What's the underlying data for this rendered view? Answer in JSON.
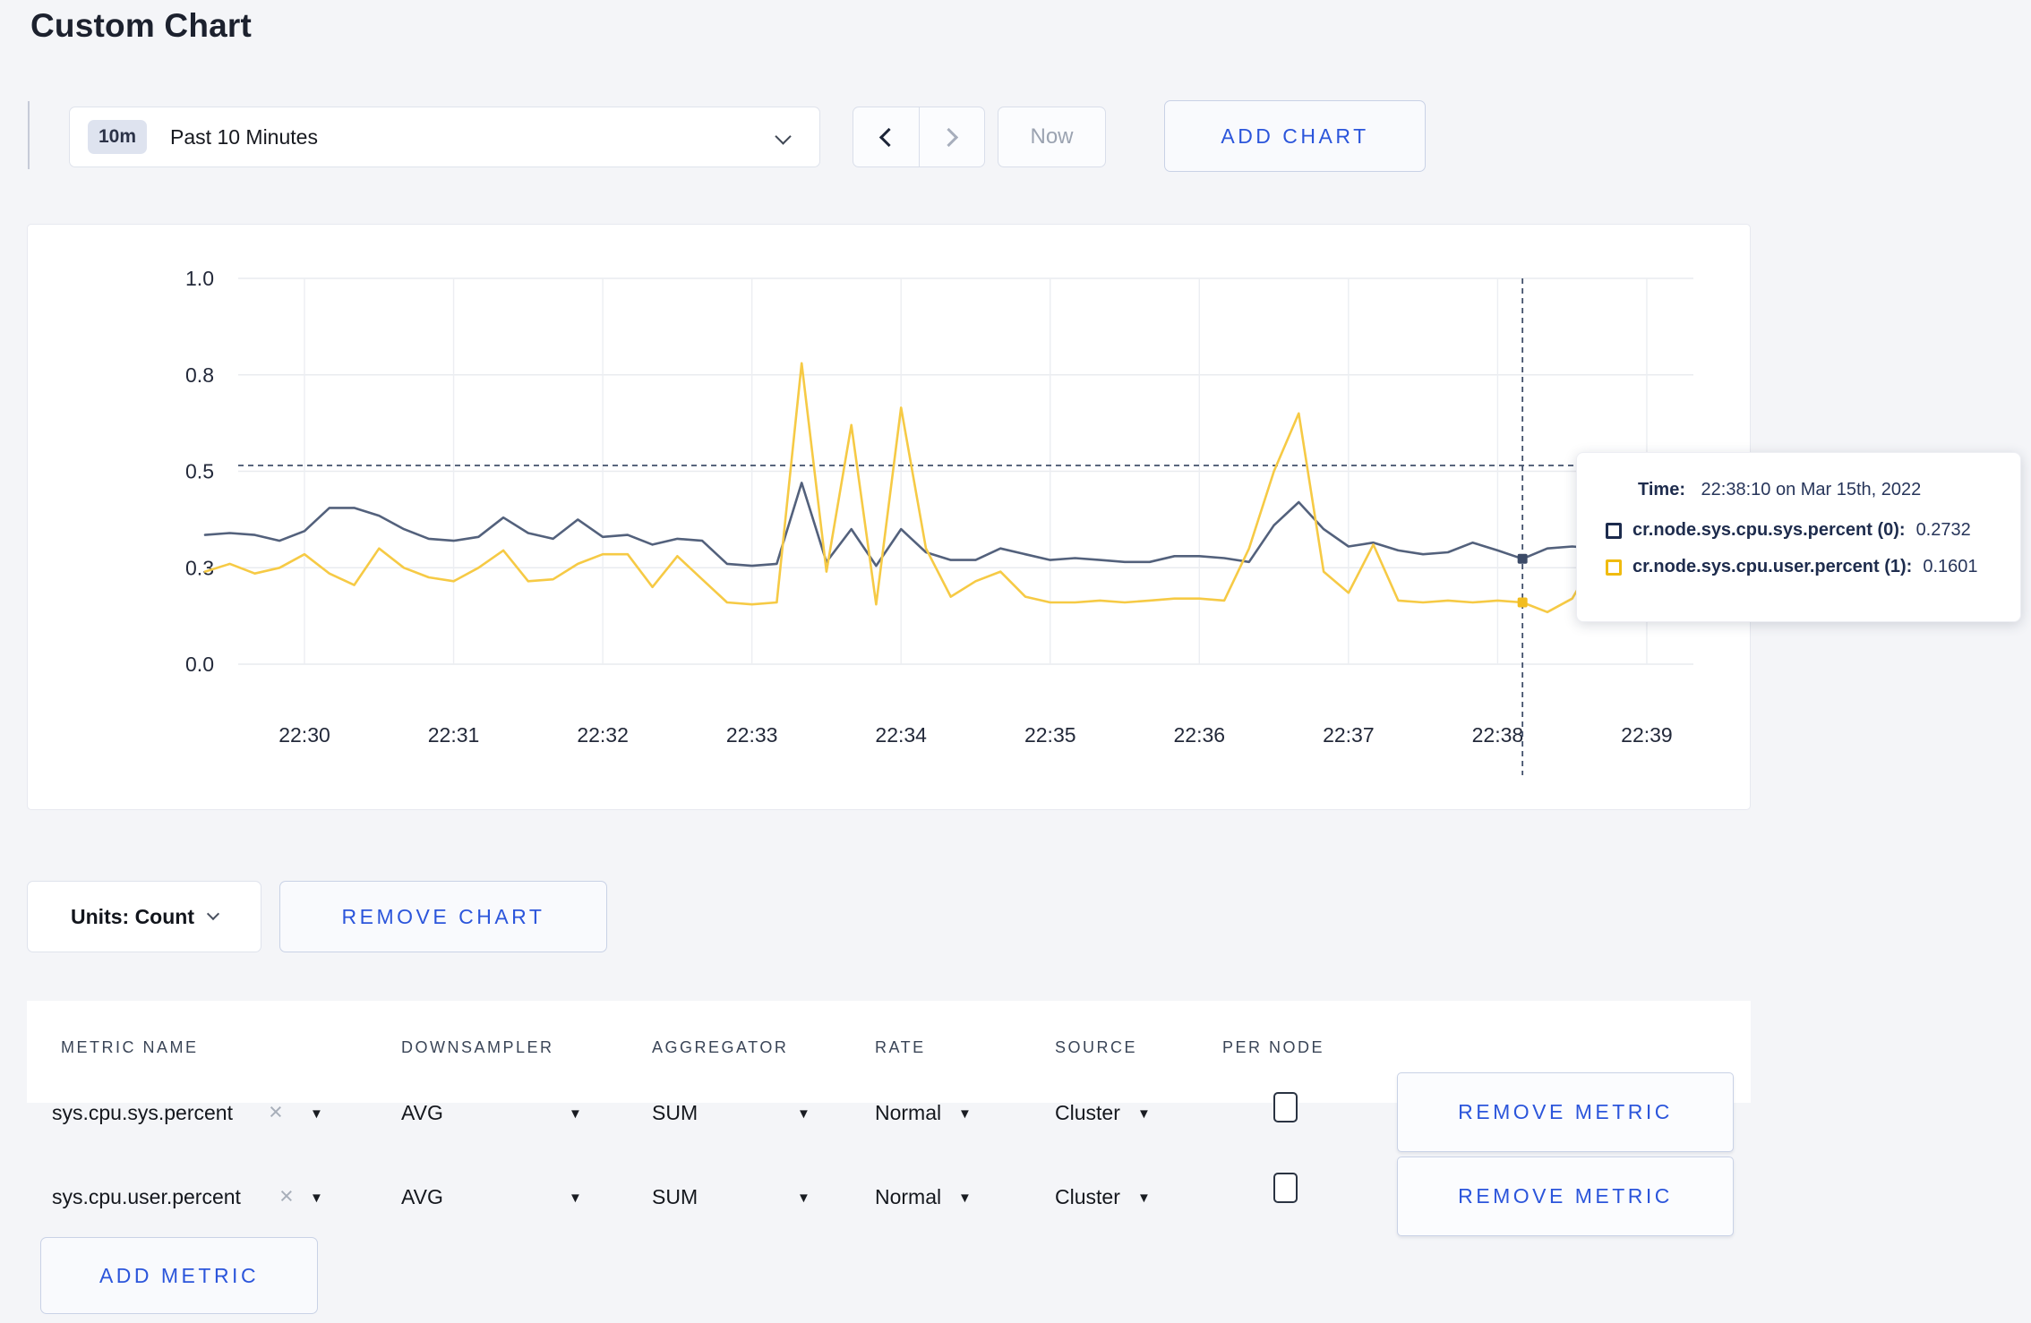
{
  "page_title": "Custom Chart",
  "toolbar": {
    "time_badge": "10m",
    "time_range_label": "Past 10 Minutes",
    "now_label": "Now",
    "add_chart_label": "ADD CHART"
  },
  "chart_data": {
    "type": "line",
    "title": "",
    "xlabel": "",
    "ylabel": "",
    "ylim": [
      0,
      1
    ],
    "grid": true,
    "x_ticks": [
      "22:30",
      "22:31",
      "22:32",
      "22:33",
      "22:34",
      "22:35",
      "22:36",
      "22:37",
      "22:38",
      "22:39"
    ],
    "y_ticks": [
      "0.0",
      "0.3",
      "0.5",
      "0.8",
      "1.0"
    ],
    "y_tick_values": [
      0,
      0.25,
      0.5,
      0.75,
      1.0
    ],
    "start_time": "22:29:20",
    "interval_seconds": 10,
    "series": [
      {
        "name": "cr.node.sys.cpu.sys.percent",
        "color": "#53617c",
        "values": [
          0.335,
          0.34,
          0.335,
          0.32,
          0.345,
          0.405,
          0.405,
          0.385,
          0.35,
          0.325,
          0.32,
          0.33,
          0.38,
          0.34,
          0.325,
          0.375,
          0.33,
          0.335,
          0.31,
          0.325,
          0.32,
          0.26,
          0.255,
          0.26,
          0.47,
          0.265,
          0.35,
          0.255,
          0.35,
          0.29,
          0.27,
          0.27,
          0.3,
          0.285,
          0.27,
          0.275,
          0.27,
          0.265,
          0.265,
          0.28,
          0.28,
          0.275,
          0.265,
          0.36,
          0.42,
          0.35,
          0.305,
          0.315,
          0.295,
          0.285,
          0.29,
          0.315,
          0.295,
          0.2732,
          0.3,
          0.305,
          0.3,
          0.295,
          0.3,
          0.305
        ]
      },
      {
        "name": "cr.node.sys.cpu.user.percent",
        "color": "#f6ca45",
        "values": [
          0.24,
          0.26,
          0.235,
          0.25,
          0.285,
          0.235,
          0.205,
          0.3,
          0.25,
          0.225,
          0.215,
          0.25,
          0.295,
          0.215,
          0.22,
          0.26,
          0.285,
          0.285,
          0.2,
          0.28,
          0.22,
          0.16,
          0.155,
          0.16,
          0.78,
          0.24,
          0.62,
          0.155,
          0.665,
          0.3,
          0.175,
          0.215,
          0.24,
          0.175,
          0.16,
          0.16,
          0.165,
          0.16,
          0.165,
          0.17,
          0.17,
          0.165,
          0.3,
          0.5,
          0.65,
          0.24,
          0.185,
          0.31,
          0.165,
          0.16,
          0.165,
          0.16,
          0.165,
          0.1601,
          0.135,
          0.17,
          0.28,
          0.22,
          0.27,
          0.24
        ]
      }
    ],
    "crosshair": {
      "time": "22:38:10",
      "hover_value": 0.515,
      "dot_values": [
        0.2732,
        0.1601
      ]
    }
  },
  "tooltip": {
    "time_label": "Time:",
    "time_value": "22:38:10 on Mar 15th, 2022",
    "rows": [
      {
        "label": "cr.node.sys.cpu.sys.percent (0):",
        "value": "0.2732",
        "color": "#1c2b4d"
      },
      {
        "label": "cr.node.sys.cpu.user.percent (1):",
        "value": "0.1601",
        "color": "#f0bb0f"
      }
    ]
  },
  "chart_footer": {
    "units_label": "Units: Count",
    "remove_chart_label": "REMOVE CHART"
  },
  "metrics_table": {
    "headers": [
      "METRIC NAME",
      "DOWNSAMPLER",
      "AGGREGATOR",
      "RATE",
      "SOURCE",
      "PER NODE"
    ],
    "rows": [
      {
        "metric": "sys.cpu.sys.percent",
        "downsampler": "AVG",
        "aggregator": "SUM",
        "rate": "Normal",
        "source": "Cluster",
        "per_node_checked": false,
        "remove_label": "REMOVE METRIC"
      },
      {
        "metric": "sys.cpu.user.percent",
        "downsampler": "AVG",
        "aggregator": "SUM",
        "rate": "Normal",
        "source": "Cluster",
        "per_node_checked": false,
        "remove_label": "REMOVE METRIC"
      }
    ],
    "add_metric_label": "ADD METRIC"
  }
}
